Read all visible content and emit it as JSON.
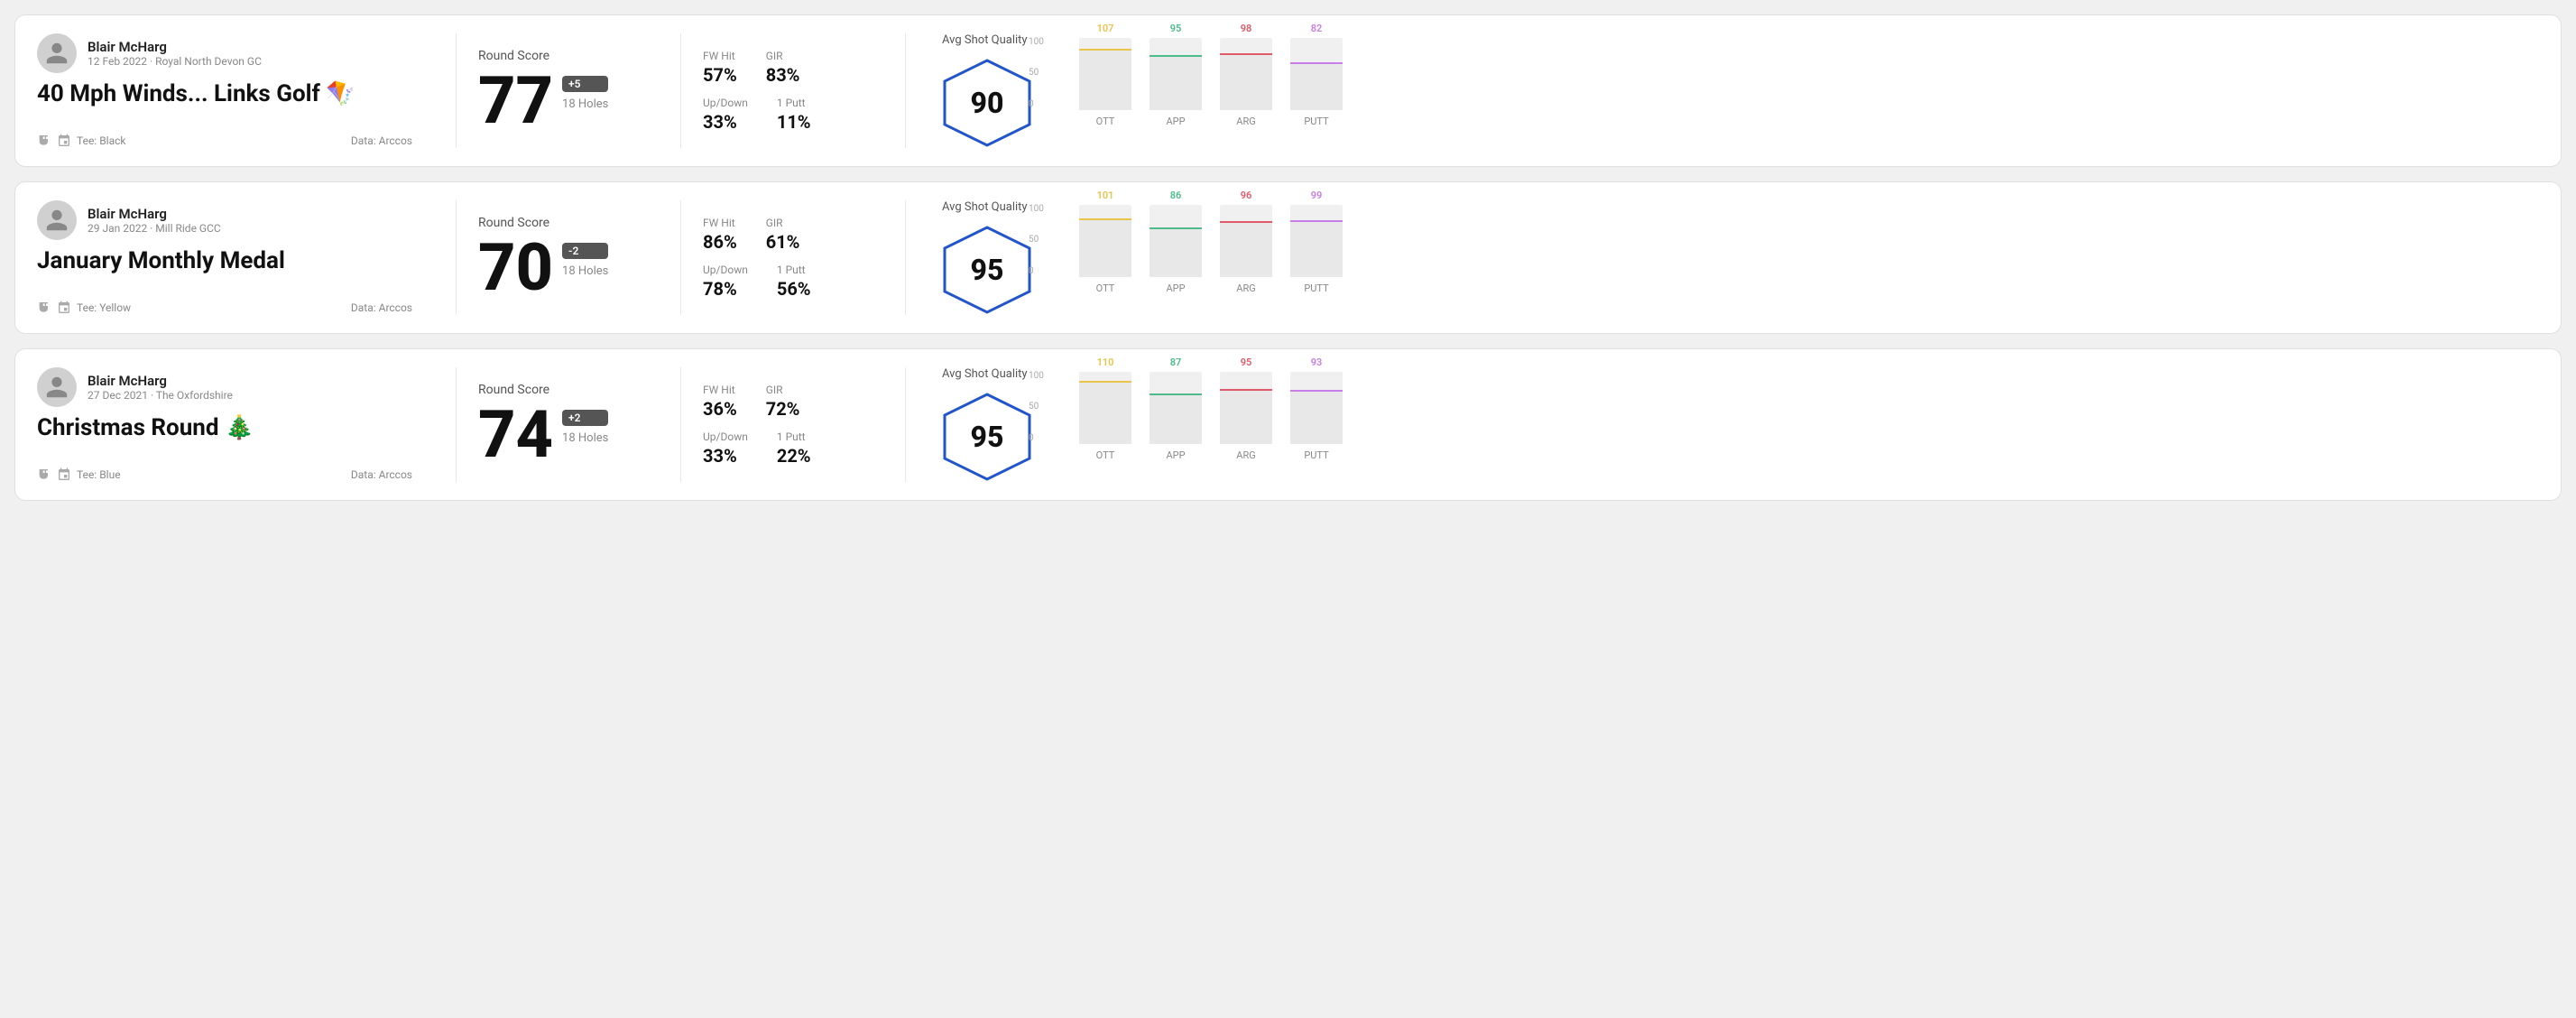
{
  "rounds": [
    {
      "id": "round1",
      "player_name": "Blair McHarg",
      "player_meta": "12 Feb 2022 · Royal North Devon GC",
      "title": "40 Mph Winds... Links Golf 🪁",
      "tee": "Black",
      "data_source": "Data: Arccos",
      "score": "77",
      "score_modifier": "+5",
      "holes": "18 Holes",
      "fw_hit_label": "FW Hit",
      "fw_hit_value": "57%",
      "gir_label": "GIR",
      "gir_value": "83%",
      "updown_label": "Up/Down",
      "updown_value": "33%",
      "oneputt_label": "1 Putt",
      "oneputt_value": "11%",
      "avg_shot_quality_label": "Avg Shot Quality",
      "avg_quality_value": "90",
      "bars": [
        {
          "label": "OTT",
          "value": 107,
          "color": "#e8c44a",
          "max": 130
        },
        {
          "label": "APP",
          "value": 95,
          "color": "#4dbb8a",
          "max": 130
        },
        {
          "label": "ARG",
          "value": 98,
          "color": "#e05a6a",
          "max": 130
        },
        {
          "label": "PUTT",
          "value": 82,
          "color": "#c97de8",
          "max": 130
        }
      ]
    },
    {
      "id": "round2",
      "player_name": "Blair McHarg",
      "player_meta": "29 Jan 2022 · Mill Ride GCC",
      "title": "January Monthly Medal",
      "tee": "Yellow",
      "data_source": "Data: Arccos",
      "score": "70",
      "score_modifier": "-2",
      "holes": "18 Holes",
      "fw_hit_label": "FW Hit",
      "fw_hit_value": "86%",
      "gir_label": "GIR",
      "gir_value": "61%",
      "updown_label": "Up/Down",
      "updown_value": "78%",
      "oneputt_label": "1 Putt",
      "oneputt_value": "56%",
      "avg_shot_quality_label": "Avg Shot Quality",
      "avg_quality_value": "95",
      "bars": [
        {
          "label": "OTT",
          "value": 101,
          "color": "#e8c44a",
          "max": 130
        },
        {
          "label": "APP",
          "value": 86,
          "color": "#4dbb8a",
          "max": 130
        },
        {
          "label": "ARG",
          "value": 96,
          "color": "#e05a6a",
          "max": 130
        },
        {
          "label": "PUTT",
          "value": 99,
          "color": "#c97de8",
          "max": 130
        }
      ]
    },
    {
      "id": "round3",
      "player_name": "Blair McHarg",
      "player_meta": "27 Dec 2021 · The Oxfordshire",
      "title": "Christmas Round 🎄",
      "tee": "Blue",
      "data_source": "Data: Arccos",
      "score": "74",
      "score_modifier": "+2",
      "holes": "18 Holes",
      "fw_hit_label": "FW Hit",
      "fw_hit_value": "36%",
      "gir_label": "GIR",
      "gir_value": "72%",
      "updown_label": "Up/Down",
      "updown_value": "33%",
      "oneputt_label": "1 Putt",
      "oneputt_value": "22%",
      "avg_shot_quality_label": "Avg Shot Quality",
      "avg_quality_value": "95",
      "bars": [
        {
          "label": "OTT",
          "value": 110,
          "color": "#e8c44a",
          "max": 130
        },
        {
          "label": "APP",
          "value": 87,
          "color": "#4dbb8a",
          "max": 130
        },
        {
          "label": "ARG",
          "value": 95,
          "color": "#e05a6a",
          "max": 130
        },
        {
          "label": "PUTT",
          "value": 93,
          "color": "#c97de8",
          "max": 130
        }
      ]
    }
  ],
  "axis_labels": {
    "top": "100",
    "mid": "50",
    "bot": "0"
  }
}
